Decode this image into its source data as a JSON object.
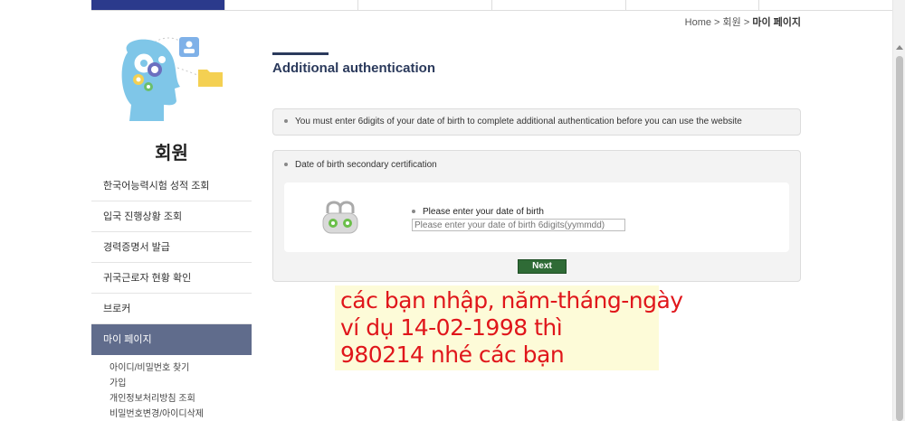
{
  "topnav": {
    "tabs": [
      "",
      "",
      "",
      "",
      "",
      ""
    ]
  },
  "breadcrumb": {
    "home": "Home",
    "sep1": " > ",
    "section": "회원",
    "sep2": " > ",
    "current": "마이 페이지"
  },
  "sidebar": {
    "title": "회원",
    "items": [
      {
        "label": "한국어능력시험 성적 조회"
      },
      {
        "label": "입국 진행상황 조회"
      },
      {
        "label": "경력증명서 발급"
      },
      {
        "label": "귀국근로자 현황 확인"
      },
      {
        "label": "브로커"
      },
      {
        "label": "마이 페이지"
      }
    ],
    "subitems": [
      {
        "label": "아이디/비밀번호 찾기"
      },
      {
        "label": "가입"
      },
      {
        "label": "개인정보처리방침 조회"
      },
      {
        "label": "비밀번호변경/아이디삭제"
      }
    ]
  },
  "main": {
    "title": "Additional authentication",
    "notice": "You must enter 6digits of your date of birth to complete additional authentication before you can use the website",
    "cert_title": "Date of birth secondary certification",
    "dob_label": "Please enter your date of birth",
    "dob_placeholder": "Please enter your date of birth 6digits(yymmdd)",
    "next_label": "Next"
  },
  "annotation": {
    "lines": [
      "các bạn nhập, năm-tháng-ngày",
      "ví dụ 14-02-1998 thì",
      "980214 nhé các bạn"
    ],
    "color": "#e0161b",
    "background": "#fdfbd8"
  },
  "colors": {
    "nav_active": "#2b3a8c",
    "menu_active": "#606c8c",
    "button": "#2f6b36",
    "title": "#2b3a5c"
  }
}
